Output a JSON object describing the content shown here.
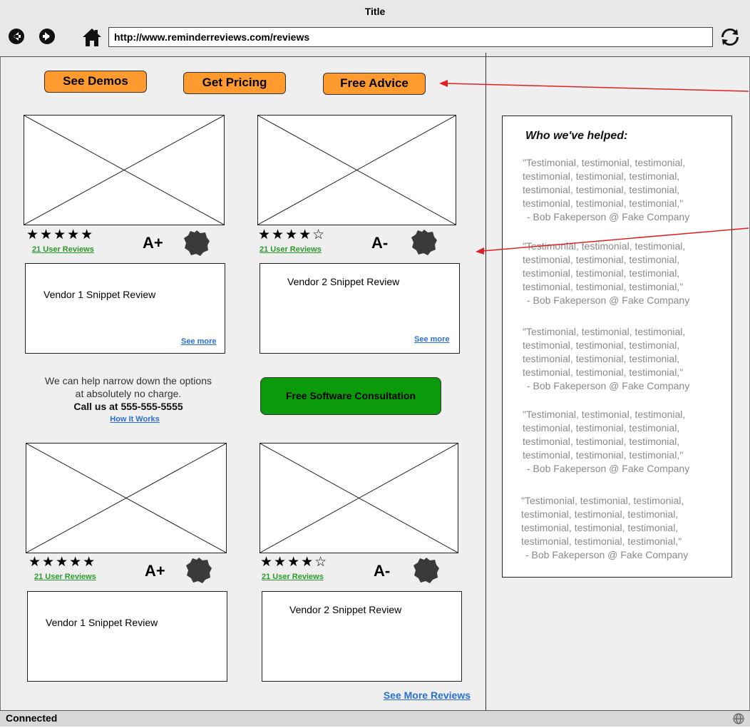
{
  "window": {
    "title": "Title",
    "url": "http://www.reminderreviews.com/reviews",
    "status": "Connected"
  },
  "toolbar": {
    "back_icon": "back-arrow-icon",
    "forward_icon": "forward-arrow-icon",
    "home_icon": "home-icon",
    "refresh_icon": "refresh-icon",
    "globe_icon": "globe-icon"
  },
  "top_buttons": {
    "demos": "See Demos",
    "pricing": "Get Pricing",
    "advice": "Free Advice"
  },
  "vendors": [
    {
      "reviews": "21 User Reviews",
      "grade": "A+",
      "stars": "★★★★★",
      "rating": 5,
      "snippet": "Vendor 1 Snippet Review",
      "see_more": "See more"
    },
    {
      "reviews": "21 User Reviews",
      "grade": "A-",
      "stars": "★★★★☆",
      "rating": 4,
      "snippet": "Vendor 2 Snippet Review",
      "see_more": "See more"
    },
    {
      "reviews": "21 User Reviews",
      "grade": "A+",
      "stars": "★★★★★",
      "rating": 5,
      "snippet": "Vendor 1 Snippet Review"
    },
    {
      "reviews": "21 User Reviews",
      "grade": "A-",
      "stars": "★★★★☆",
      "rating": 4,
      "snippet": "Vendor 2 Snippet Review"
    }
  ],
  "help": {
    "line1": "We can help narrow down the options",
    "line2": "at absolutely no charge.",
    "phone": "Call us at 555-555-5555",
    "how_it_works": "How It Works",
    "consult_button": "Free Software Consultation"
  },
  "see_more_reviews": "See More Reviews",
  "testimonials": {
    "heading": "Who we've helped:",
    "items": [
      {
        "quote": "\"Testimonial, testimonial,  testimonial,\ntestimonial, testimonial, testimonial,\ntestimonial, testimonial, testimonial,\ntestimonial, testimonial, testimonial,\"",
        "author": "- Bob Fakeperson @ Fake Company"
      },
      {
        "quote": "\"Testimonial, testimonial,  testimonial,\ntestimonial, testimonial, testimonial,\ntestimonial, testimonial, testimonial,\ntestimonial, testimonial, testimonial,\"",
        "author": "- Bob Fakeperson @ Fake Company"
      },
      {
        "quote": "\"Testimonial, testimonial,  testimonial,\ntestimonial, testimonial, testimonial,\ntestimonial, testimonial, testimonial,\ntestimonial, testimonial, testimonial,\"",
        "author": "- Bob Fakeperson @ Fake Company"
      },
      {
        "quote": "\"Testimonial, testimonial,  testimonial,\ntestimonial, testimonial, testimonial,\ntestimonial, testimonial, testimonial,\ntestimonial, testimonial, testimonial,\"",
        "author": "- Bob Fakeperson @ Fake Company"
      },
      {
        "quote": "\"Testimonial, testimonial,  testimonial,\ntestimonial, testimonial, testimonial,\ntestimonial, testimonial, testimonial,\ntestimonial, testimonial, testimonial,\"",
        "author": "- Bob Fakeperson @ Fake Company"
      }
    ]
  },
  "colors": {
    "orange_button": "#ff9a2e",
    "green_button": "#0a9a0a",
    "link_blue": "#2a6fd6",
    "link_green": "#2a9b2a",
    "annotation_red": "#e02020"
  }
}
